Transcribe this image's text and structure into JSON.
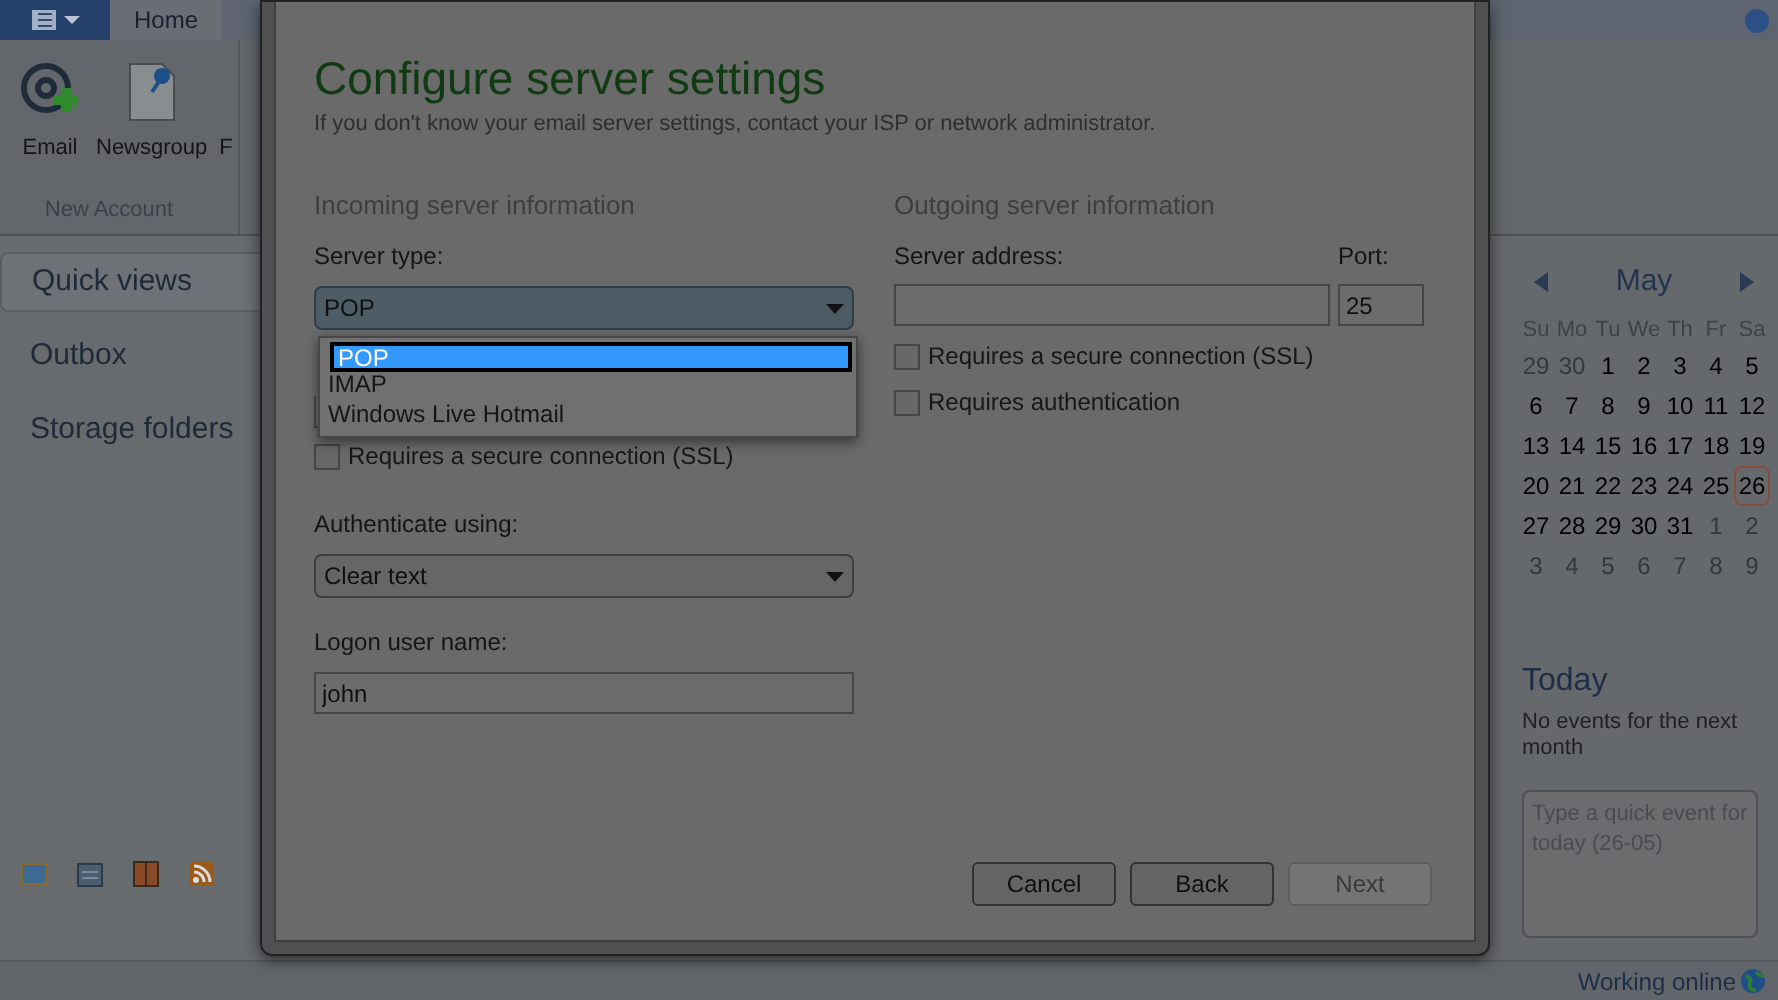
{
  "ribbon": {
    "tabs": [
      {
        "label": "Home",
        "selected": true
      }
    ],
    "buttons": [
      {
        "label": "Email",
        "kind": "email"
      },
      {
        "label": "Newsgroup",
        "kind": "newsgroup"
      },
      {
        "label": "F",
        "kind": "partial"
      }
    ],
    "group_label": "New Account"
  },
  "sidebar": {
    "items": [
      {
        "label": "Quick views",
        "selected": true
      },
      {
        "label": "Outbox",
        "selected": false
      },
      {
        "label": "Storage folders",
        "selected": false
      }
    ]
  },
  "dialog": {
    "title": "Configure server settings",
    "subtitle": "If you don't know your email server settings, contact your ISP or network administrator.",
    "incoming": {
      "heading": "Incoming server information",
      "server_type_label": "Server type:",
      "server_type_value": "POP",
      "options": [
        {
          "label": "POP",
          "selected": true
        },
        {
          "label": "IMAP",
          "selected": false
        },
        {
          "label": "Windows Live Hotmail",
          "selected": false
        }
      ],
      "ssl": {
        "label": "Requires a secure connection (SSL)",
        "checked": false
      },
      "auth_label": "Authenticate using:",
      "auth_value": "Clear text",
      "user_label": "Logon user name:",
      "user_value": "john"
    },
    "outgoing": {
      "heading": "Outgoing server information",
      "address_label": "Server address:",
      "port_label": "Port:",
      "port_value": "25",
      "checks": [
        {
          "label": "Requires a secure connection (SSL)",
          "checked": false
        },
        {
          "label": "Requires authentication",
          "checked": false
        }
      ]
    },
    "buttons": [
      {
        "label": "Cancel",
        "disabled": false
      },
      {
        "label": "Back",
        "disabled": false
      },
      {
        "label": "Next",
        "disabled": true
      }
    ]
  },
  "calendar": {
    "month": "May",
    "weekdays": [
      "Su",
      "Mo",
      "Tu",
      "We",
      "Th",
      "Fr",
      "Sa"
    ],
    "days": [
      {
        "label": "29",
        "other_month": true,
        "selected": false
      },
      {
        "label": "30",
        "other_month": true,
        "selected": false
      },
      {
        "label": "1",
        "other_month": false,
        "selected": false
      },
      {
        "label": "2",
        "other_month": false,
        "selected": false
      },
      {
        "label": "3",
        "other_month": false,
        "selected": false
      },
      {
        "label": "4",
        "other_month": false,
        "selected": false
      },
      {
        "label": "5",
        "other_month": false,
        "selected": false
      },
      {
        "label": "6",
        "other_month": false,
        "selected": false
      },
      {
        "label": "7",
        "other_month": false,
        "selected": false
      },
      {
        "label": "8",
        "other_month": false,
        "selected": false
      },
      {
        "label": "9",
        "other_month": false,
        "selected": false
      },
      {
        "label": "10",
        "other_month": false,
        "selected": false
      },
      {
        "label": "11",
        "other_month": false,
        "selected": false
      },
      {
        "label": "12",
        "other_month": false,
        "selected": false
      },
      {
        "label": "13",
        "other_month": false,
        "selected": false
      },
      {
        "label": "14",
        "other_month": false,
        "selected": false
      },
      {
        "label": "15",
        "other_month": false,
        "selected": false
      },
      {
        "label": "16",
        "other_month": false,
        "selected": false
      },
      {
        "label": "17",
        "other_month": false,
        "selected": false
      },
      {
        "label": "18",
        "other_month": false,
        "selected": false
      },
      {
        "label": "19",
        "other_month": false,
        "selected": false
      },
      {
        "label": "20",
        "other_month": false,
        "selected": false
      },
      {
        "label": "21",
        "other_month": false,
        "selected": false
      },
      {
        "label": "22",
        "other_month": false,
        "selected": false
      },
      {
        "label": "23",
        "other_month": false,
        "selected": false
      },
      {
        "label": "24",
        "other_month": false,
        "selected": false
      },
      {
        "label": "25",
        "other_month": false,
        "selected": false
      },
      {
        "label": "26",
        "other_month": false,
        "selected": true
      },
      {
        "label": "27",
        "other_month": false,
        "selected": false
      },
      {
        "label": "28",
        "other_month": false,
        "selected": false
      },
      {
        "label": "29",
        "other_month": false,
        "selected": false
      },
      {
        "label": "30",
        "other_month": false,
        "selected": false
      },
      {
        "label": "31",
        "other_month": false,
        "selected": false
      },
      {
        "label": "1",
        "other_month": true,
        "selected": false
      },
      {
        "label": "2",
        "other_month": true,
        "selected": false
      },
      {
        "label": "3",
        "other_month": true,
        "selected": false
      },
      {
        "label": "4",
        "other_month": true,
        "selected": false
      },
      {
        "label": "5",
        "other_month": true,
        "selected": false
      },
      {
        "label": "6",
        "other_month": true,
        "selected": false
      },
      {
        "label": "7",
        "other_month": true,
        "selected": false
      },
      {
        "label": "8",
        "other_month": true,
        "selected": false
      },
      {
        "label": "9",
        "other_month": true,
        "selected": false
      }
    ],
    "today_heading": "Today",
    "today_text": "No events for the next month",
    "quick_event_placeholder": "Type a quick event for today (26-05)"
  },
  "status_bar": {
    "text": "Working online"
  }
}
